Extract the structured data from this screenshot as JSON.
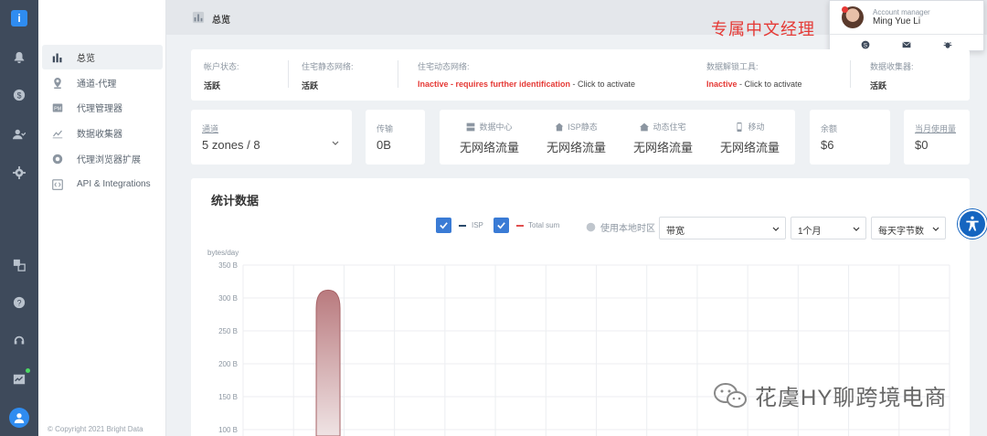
{
  "header": {
    "title": "总览",
    "promo": "专属中文经理"
  },
  "account_manager": {
    "role": "Account manager",
    "name": "Ming Yue Li",
    "status_color": "#e53935"
  },
  "nav": {
    "items": [
      {
        "label": "总览",
        "icon": "bar-chart-icon",
        "active": true
      },
      {
        "label": "通道-代理",
        "icon": "location-pin-icon"
      },
      {
        "label": "代理管理器",
        "icon": "pm-icon"
      },
      {
        "label": "数据收集器",
        "icon": "line-chart-icon"
      },
      {
        "label": "代理浏览器扩展",
        "icon": "chrome-icon"
      },
      {
        "label": "API & Integrations",
        "icon": "code-icon"
      }
    ],
    "copyright": "© Copyright 2021 Bright Data"
  },
  "status": {
    "account": {
      "label": "帐户状态:",
      "value": "活跃"
    },
    "static_res": {
      "label": "住宅静态网络:",
      "value": "活跃"
    },
    "dynamic_res": {
      "label": "住宅动态网络:",
      "value_red": "Inactive - requires further identification",
      "value_rest": " - Click to activate"
    },
    "unlocker": {
      "label": "数据解锁工具:",
      "value_red": "Inactive",
      "value_rest": " - Click to activate"
    },
    "collector": {
      "label": "数据收集器:",
      "value": "活跃"
    }
  },
  "zones": {
    "label": "通道",
    "value": "5 zones  / 8"
  },
  "transfer": {
    "label": "传输",
    "value": "0B"
  },
  "traffic": [
    {
      "label": "数据中心",
      "value": "无网络流量",
      "icon": "server-icon"
    },
    {
      "label": "ISP静态",
      "value": "无网络流量",
      "icon": "house-icon"
    },
    {
      "label": "动态住宅",
      "value": "无网络流量",
      "icon": "home-icon"
    },
    {
      "label": "移动",
      "value": "无网络流量",
      "icon": "mobile-icon"
    }
  ],
  "balance": {
    "label": "余额",
    "value": "$6"
  },
  "month_usage": {
    "label": "当月使用量",
    "value": "$0"
  },
  "stats": {
    "title": "统计数据",
    "legend": [
      {
        "label": "ISP",
        "color": "#2a4a6b"
      },
      {
        "label": "Total sum",
        "color": "#e05050"
      }
    ],
    "timezone_label": "使用本地时区",
    "metric_select": "带宽",
    "period_select": "1个月",
    "unit_select": "每天字节数"
  },
  "chart_data": {
    "type": "area",
    "ylabel": "bytes/day",
    "y_ticks": [
      "350 B",
      "300 B",
      "250 B",
      "200 B",
      "150 B",
      "100 B"
    ],
    "ylim": [
      0,
      350
    ],
    "y_tick_values": [
      350,
      300,
      250,
      200,
      150,
      100
    ],
    "x_count": 14,
    "series": [
      {
        "name": "Total sum",
        "color": "#b97a7e",
        "values": [
          0,
          0,
          312,
          0,
          0,
          0,
          0,
          0,
          0,
          0,
          0,
          0,
          0,
          0
        ]
      }
    ],
    "grid": true
  },
  "watermark": "花虞HY聊跨境电商"
}
